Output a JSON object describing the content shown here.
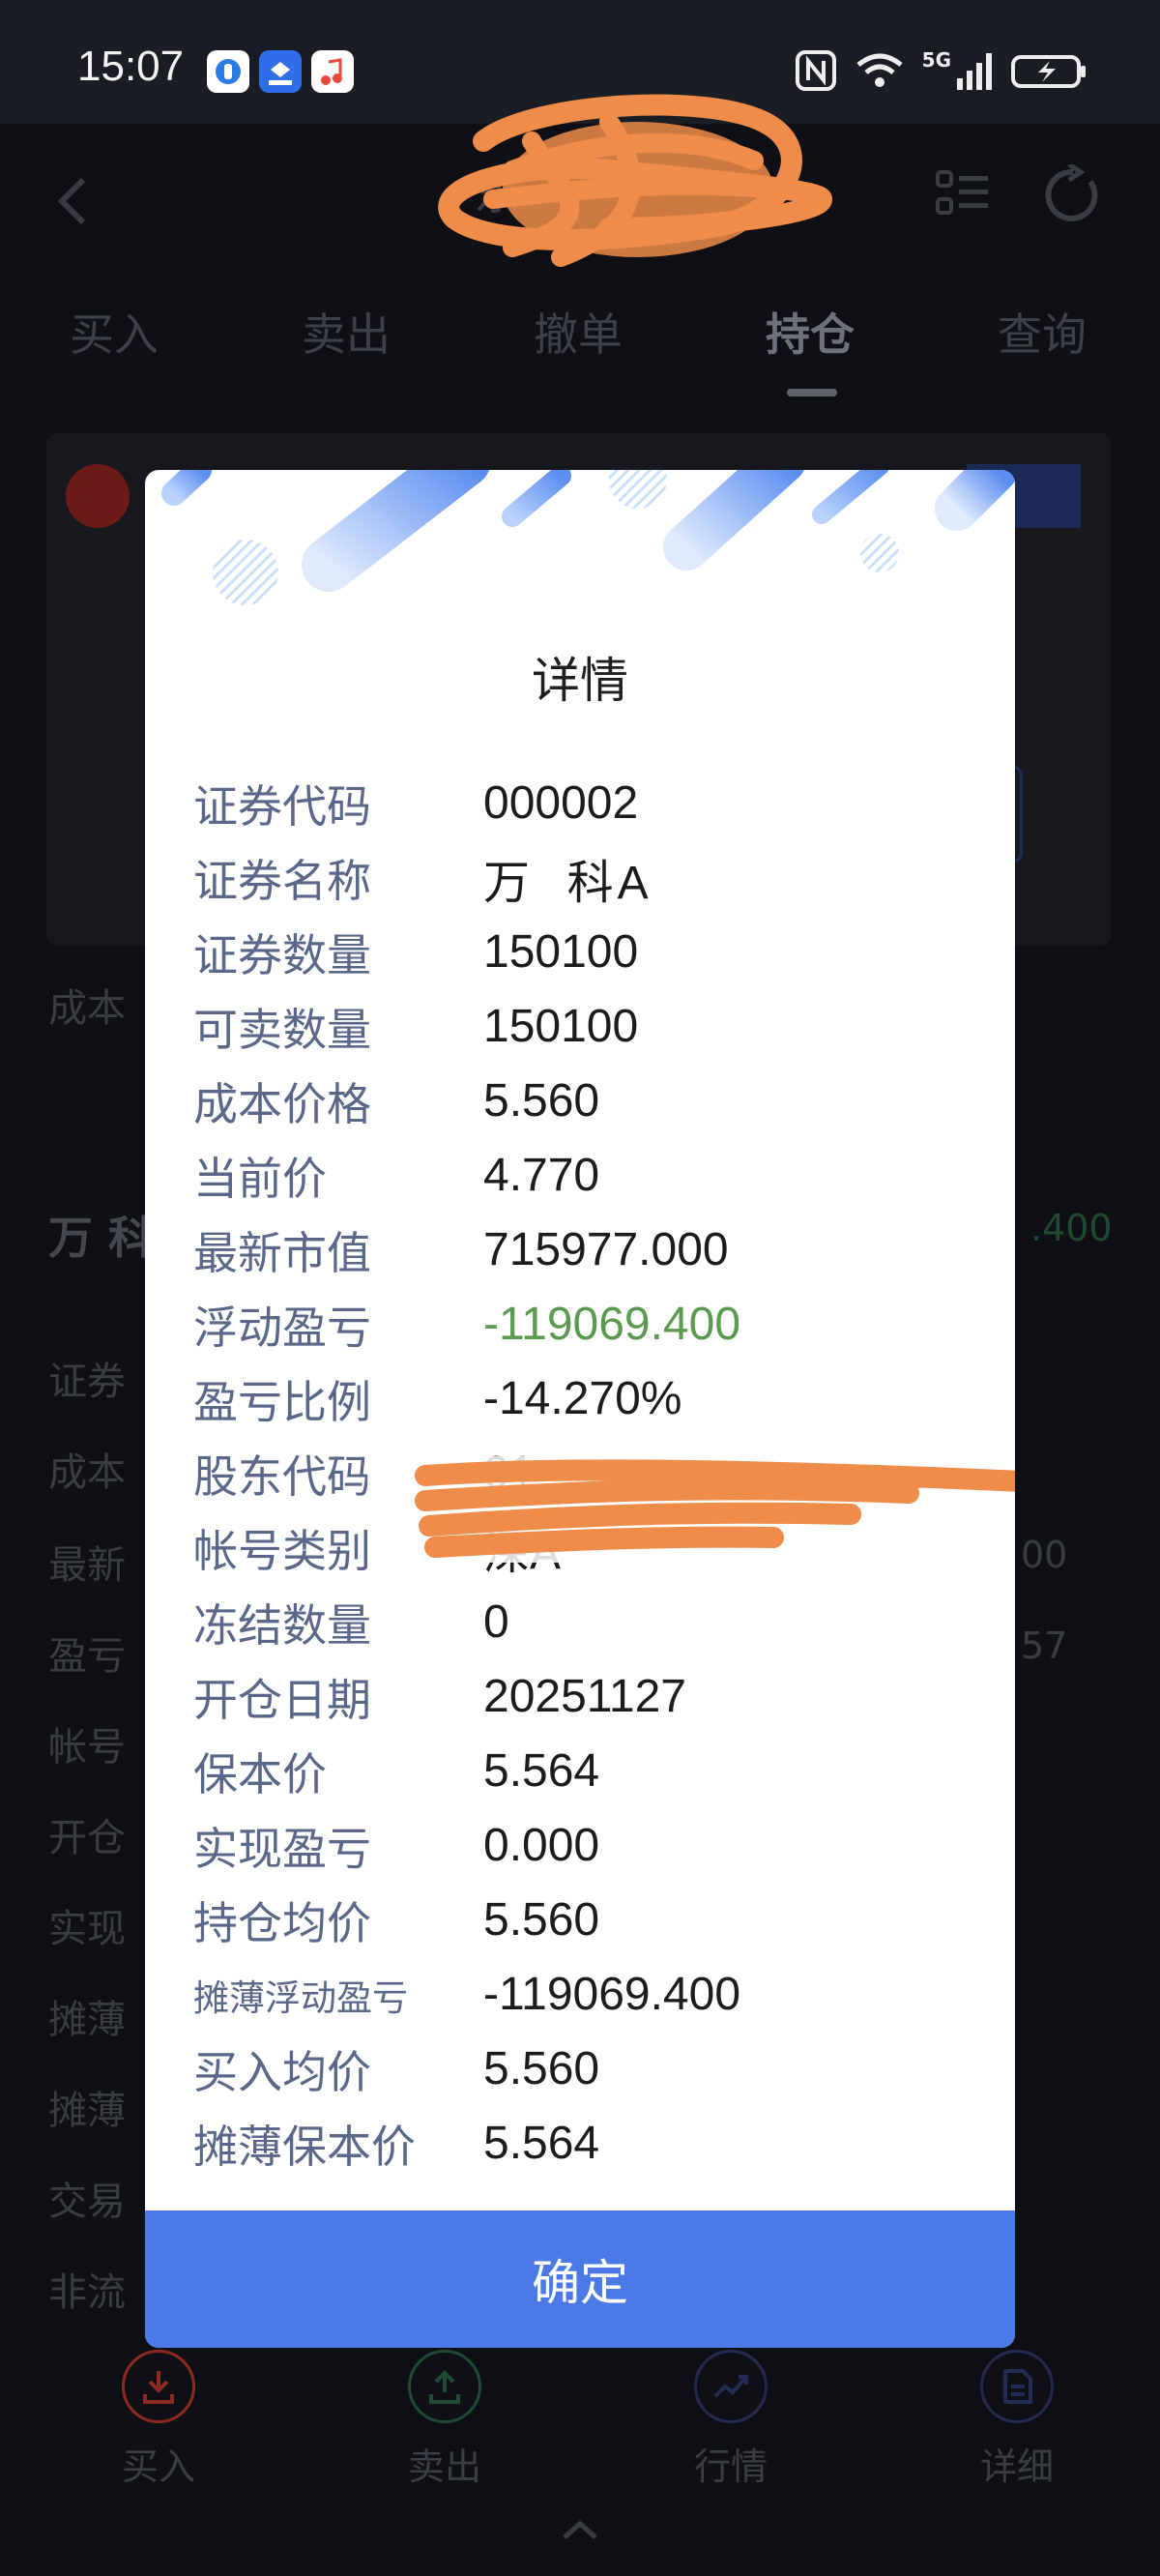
{
  "status_bar": {
    "time": "15:07",
    "network": "5G"
  },
  "header": {
    "title_visible": "东"
  },
  "tabs": [
    {
      "label": "买入"
    },
    {
      "label": "卖出"
    },
    {
      "label": "撤单"
    },
    {
      "label": "持仓"
    },
    {
      "label": "查询"
    }
  ],
  "background": {
    "section_label": "成本",
    "holding_name": "万 科",
    "holding_right_value": ".400",
    "labels": [
      "证券",
      "成本",
      "最新",
      "盈亏",
      "帐号",
      "开仓",
      "实现",
      "摊薄",
      "摊薄",
      "交易",
      "非流"
    ],
    "right_values": [
      "00",
      "57"
    ]
  },
  "dialog": {
    "title": "详情",
    "rows": [
      {
        "label": "证券代码",
        "value": "000002"
      },
      {
        "label": "证券名称",
        "value": "万  科A"
      },
      {
        "label": "证券数量",
        "value": "150100"
      },
      {
        "label": "可卖数量",
        "value": "150100"
      },
      {
        "label": "成本价格",
        "value": "5.560"
      },
      {
        "label": "当前价",
        "value": "4.770"
      },
      {
        "label": "最新市值",
        "value": "715977.000"
      },
      {
        "label": "浮动盈亏",
        "value": "-119069.400"
      },
      {
        "label": "盈亏比例",
        "value": "-14.270%"
      },
      {
        "label": "股东代码",
        "value": "01"
      },
      {
        "label": "帐号类别",
        "value": "深A"
      },
      {
        "label": "冻结数量",
        "value": "0"
      },
      {
        "label": "开仓日期",
        "value": "20251127"
      },
      {
        "label": "保本价",
        "value": "5.564"
      },
      {
        "label": "实现盈亏",
        "value": "0.000"
      },
      {
        "label": "持仓均价",
        "value": "5.560"
      },
      {
        "label": "摊薄浮动盈亏",
        "value": "-119069.400"
      },
      {
        "label": "买入均价",
        "value": "5.560"
      },
      {
        "label": "摊薄保本价",
        "value": "5.564"
      }
    ],
    "confirm_label": "确定",
    "colors": {
      "accent": "#4b7ae6",
      "label": "#5a6788",
      "loss_green": "#5a9a4e"
    }
  },
  "bottom_nav": [
    {
      "label": "买入",
      "icon": "download-icon",
      "color": "#8c2a22"
    },
    {
      "label": "卖出",
      "icon": "upload-icon",
      "color": "#1f4a34"
    },
    {
      "label": "行情",
      "icon": "trend-chart-icon",
      "color": "#232b52"
    },
    {
      "label": "详细",
      "icon": "document-icon",
      "color": "#232b52"
    }
  ]
}
